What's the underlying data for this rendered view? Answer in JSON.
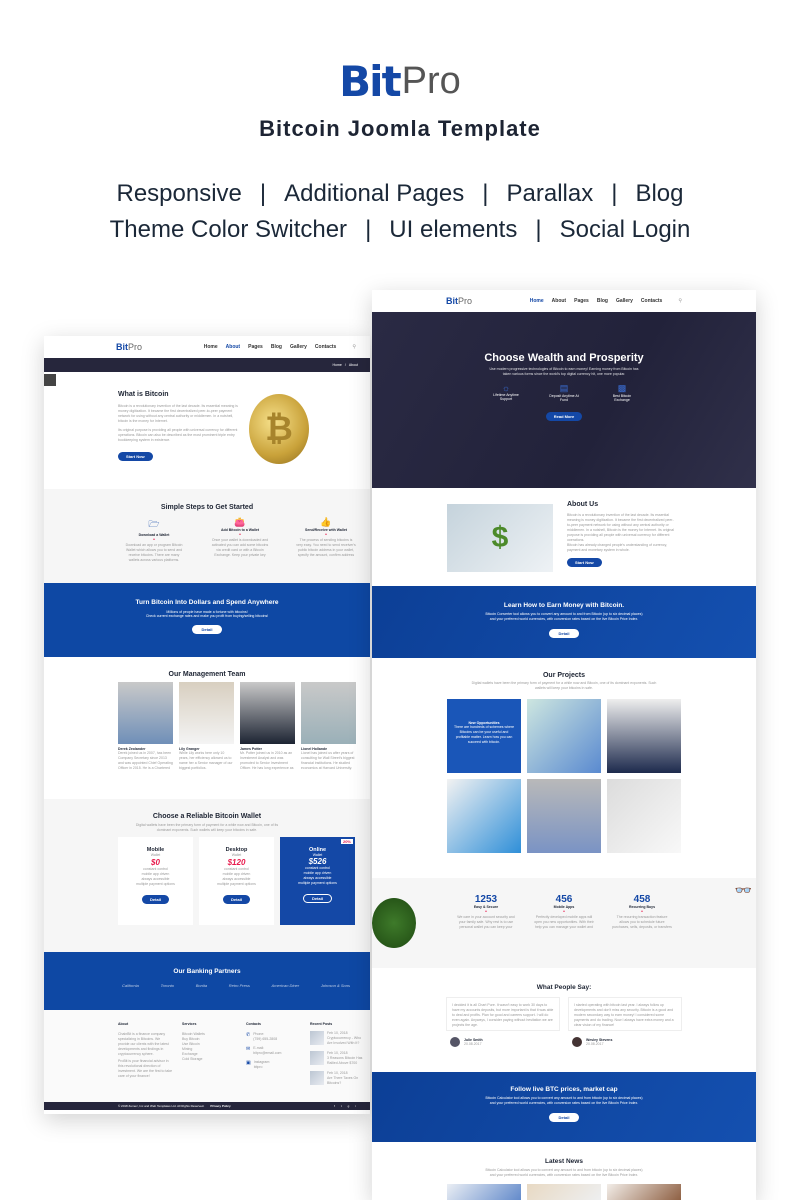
{
  "hero": {
    "logo_mark": "Bit",
    "logo_text": "Pro",
    "subtitle": "Bitcoin Joomla Template",
    "features_row1": [
      "Responsive",
      "Additional Pages",
      "Parallax",
      "Blog"
    ],
    "features_row2": [
      "Theme Color Switcher",
      "UI elements",
      "Social Login"
    ],
    "separator": "|"
  },
  "colors": {
    "brand_blue": "#1448a6",
    "dark_navy": "#26263c",
    "accent_red": "#e8194b"
  },
  "left_page": {
    "nav": {
      "logo_mark": "Bit",
      "logo_text": "Pro",
      "items": [
        "Home",
        "About",
        "Pages",
        "Blog",
        "Gallery",
        "Contacts"
      ],
      "active": "About"
    },
    "breadcrumb": [
      "Home",
      "About"
    ],
    "about": {
      "title": "What is Bitcoin",
      "text1": "Bitcoin is a revolutionary invention of the last decade. Its essential meaning is money digitization. It became the first decentralized peer-to-peer payment network for using without any central authority or middlemen. In a nutshell, bitcoin is the money for Internet.",
      "text2": "Its original purpose is providing all people with universal currency for different operations. Bitcoin can also be described as the most prominent triple entry bookkeeping system in existence.",
      "button": "Start Now"
    },
    "steps": {
      "title": "Simple Steps to Get Started",
      "items": [
        {
          "icon": "download-folder-icon",
          "title": "Download a Wallet",
          "text": "Download an app or program Bitcoin Wallet which allows you to send and receive bitcoins. There are many wallets across various platforms."
        },
        {
          "icon": "wallet-icon",
          "title": "Add Bitcoin to a Wallet",
          "text": "Once your wallet is downloaded and activated you can add some bitcoins via credit card or with a Bitcoin Exchange. Keep your private key secure."
        },
        {
          "icon": "thumbs-up-icon",
          "title": "Send/Receive with Wallet",
          "text": "The process of sending bitcoins is very easy. You need to send receiver's public bitcoin address in your wallet, specify the amount, confirm address and send."
        }
      ]
    },
    "banner": {
      "title": "Turn Bitcoin Into Dollars and Spend Anywhere",
      "text1": "Millions of people have made a fortune with bitcoins!",
      "text2": "Check current exchange rates and make you profit from buying/selling bitcoins!",
      "button": "Detail"
    },
    "team": {
      "title": "Our Management Team",
      "members": [
        {
          "name": "Derek Zeolander",
          "bio": "Derek joined us in 2007, has been Company Secretary since 2013 and was appointed Chief Operating Officer in 2015. He is a Chartered Accountant."
        },
        {
          "name": "Lily Granger",
          "bio": "While Lily works here only 10 years, her efficiency allowed us to name her a Senior manager of our biggest portfolios."
        },
        {
          "name": "James Potter",
          "bio": "Mr. Potter joined us in 2010 as an Investment Analyst and was promoted to Senior Investment Officer. He has long experience as an analyst."
        },
        {
          "name": "Lionel Hollande",
          "bio": "Lionel has joined us after years of consulting for Wall Street's biggest financial institutions. He studied economics at Harvard University."
        }
      ]
    },
    "wallets": {
      "title": "Choose a Reliable Bitcoin Wallet",
      "text": "Digital wallets have been the primary form of payment for a while now and Bitcoin, one of its dominant exponents. Such wallets will keep your bitcoins in safe.",
      "plans": [
        {
          "name": "Mobile",
          "sub": "Wallet",
          "price": "$0",
          "features": [
            "constant control",
            "mobile app driven",
            "always accessible",
            "multiple payment options"
          ],
          "button": "Detail",
          "featured": false
        },
        {
          "name": "Desktop",
          "sub": "Wallet",
          "price": "$120",
          "features": [
            "constant control",
            "mobile app driven",
            "always accessible",
            "multiple payment options"
          ],
          "button": "Detail",
          "featured": false
        },
        {
          "name": "Online",
          "sub": "Wallet",
          "price": "$526",
          "features": [
            "constant control",
            "mobile app driven",
            "always accessible",
            "multiple payment options"
          ],
          "button": "Detail",
          "featured": true,
          "ribbon": "20%"
        }
      ]
    },
    "partners": {
      "title": "Our Banking Partners",
      "logos": [
        "California",
        "Toronto",
        "Bonita",
        "Retro Press",
        "American Diner",
        "Johnson & Sons"
      ]
    },
    "footer": {
      "about": {
        "title": "About",
        "text1": "ChainBit is a finance company specializing in Bitcoins. We provide our clients with the latest developments and findings in cryptocurrency sphere.",
        "text2": "ProBit is your financial advisor in this revolutional direction of investment. We are the first to take care of your finance!"
      },
      "services": {
        "title": "Services",
        "items": [
          "Bitcoin Wallets",
          "Buy Bitcoin",
          "Use Bitcoin",
          "Mining",
          "Exchange",
          "Cold Storage"
        ]
      },
      "contacts": {
        "title": "Contacts",
        "items": [
          {
            "icon": "phone-icon",
            "label": "Phone:",
            "value": "(759) 655-2808"
          },
          {
            "icon": "email-icon",
            "label": "E-mail:",
            "value": "bitpro@email.com"
          },
          {
            "icon": "instagram-icon",
            "label": "Instagram:",
            "value": "bitpro"
          }
        ]
      },
      "posts": {
        "title": "Recent Posts",
        "items": [
          {
            "date": "Feb 10, 2018",
            "title": "Cryptocurrency - Who Are Involved With It?"
          },
          {
            "date": "Feb 10, 2018",
            "title": "3 Reasons Bitcoin Has Rallied Above $700"
          },
          {
            "date": "Feb 10, 2018",
            "title": "Are There Taxes On Bitcoins?"
          }
        ]
      },
      "copyright": "© 2018 Zemez, Inc and Web Templates Ltd. All Rights Reserved.",
      "privacy": "Privacy Policy",
      "social": [
        "f",
        "t",
        "g",
        "i"
      ]
    }
  },
  "right_page": {
    "nav": {
      "logo_mark": "Bit",
      "logo_text": "Pro",
      "items": [
        "Home",
        "About",
        "Pages",
        "Blog",
        "Gallery",
        "Contacts"
      ],
      "active": "Home"
    },
    "slider": {
      "title": "Choose Wealth and Prosperity",
      "text": "Use modern progressive technologies of Bitcoin to earn money! Earning money from Bitcoin has taken various forms since the world's top digital currency hit, one more popular.",
      "features": [
        {
          "icon": "headset-icon",
          "label": "Lifetime Anytime Support"
        },
        {
          "icon": "briefcase-icon",
          "label": "Deposit Anytime At Fund"
        },
        {
          "icon": "exchange-icon",
          "label": "Best Bitcoin Exchange"
        }
      ],
      "button": "Read More"
    },
    "about": {
      "title": "About Us",
      "text1": "Bitcoin is a revolutionary invention of the last decade. Its essential meaning is money digitization. It became the first decentralized peer-to-peer payment network for using without any central authority or middlemen. In a nutshell, Bitcoin is the money for Internet. Its original purpose is providing all people with universal currency for different operations.",
      "text2": "Bitcoin has already changed people's understanding of currency, payment and monetary system in whole.",
      "button": "Start Now"
    },
    "earn": {
      "title": "Learn How to Earn Money with Bitcoin.",
      "text": "Bitcoin Converter tool allows you to convert any amount to and from Bitcoin (up to six decimal places) and your preferred world currencies, with conversion rates based on the live Bitcoin Price Index.",
      "button": "Detail"
    },
    "projects": {
      "title": "Our Projects",
      "text": "Digital wallets have been the primary form of payment for a while now and Bitcoin, one of its dominant exponents. Such wallets will keep your bitcoins in safe.",
      "overlay_title": "New Opportunities",
      "overlay_text": "There are hundreds of schemes where Bitcoins can be your useful and profitable matter. Learn how you can succeed with bitcoin."
    },
    "stats": [
      {
        "value": "1253",
        "label": "Easy & Secure",
        "text": "We care in your account security and your family safe. Why rest is to use personal wallet you can keep your bitcoins in safe."
      },
      {
        "value": "456",
        "label": "Mobile Apps",
        "text": "Perfectly developed mobile apps will open you new opportunities. With their help you can manage your wallet and operate with bitcoin."
      },
      {
        "value": "458",
        "label": "Recurring Buys",
        "text": "The recurring transaction feature allows you to schedule future purchases, sells, deposits, or transfers with just a few clicks."
      }
    ],
    "testimonials": {
      "title": "What People Say:",
      "items": [
        {
          "text": "I decided it is all Chart Pure. It wasn't easy to work 30 days to have my accounts deposits, but more important is that it was able to deal and profits. Plan for good and careers support. I will do even again. Anyways, I consider paying without hesitation we are projects the age.",
          "name": "Julie Smith",
          "date": "20.08.2017"
        },
        {
          "text": "I started operating with bitcoin last year. I always follow up developments and don't miss any security. Bitcoin is a good and modern secondary way to earn money! I considered some payments and do trading. Now I always have extra money and a clear vision of my finance!",
          "name": "Wesley Stevens",
          "date": "20.08.2017"
        }
      ]
    },
    "btc": {
      "title": "Follow live BTC prices, market cap",
      "text": "Bitcoin Calculator tool allows you to convert any amount to and from bitcoin (up to six decimal places) and your preferred world currencies, with conversion rates based on the live Bitcoin Price Index.",
      "button": "Detail"
    },
    "news": {
      "title": "Latest News",
      "text": "Bitcoin Calculator tool allows you to convert any amount to and from bitcoin (up to six decimal places) and your preferred world currencies, with conversion rates based on the live Bitcoin Price Index."
    }
  }
}
